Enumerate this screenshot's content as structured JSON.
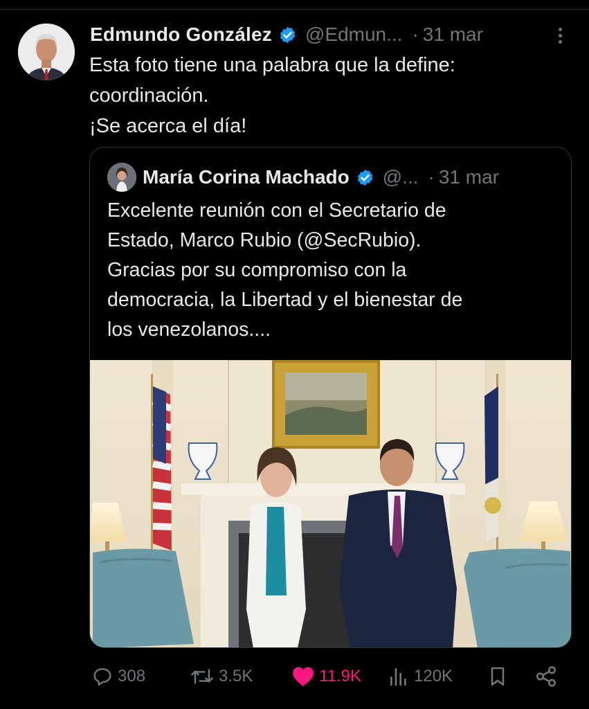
{
  "tweet": {
    "author_name": "Edmundo González",
    "author_handle": "@Edmun...",
    "separator": "·",
    "date": "31 mar",
    "text_lines": [
      "Esta foto tiene una palabra que la define:",
      "coordinación.",
      "¡Se acerca el día!"
    ]
  },
  "quoted": {
    "author_name": "María Corina Machado",
    "author_handle": "@...",
    "separator": "·",
    "date": "31 mar",
    "text_lines": [
      "Excelente reunión con el Secretario de",
      "Estado, Marco Rubio (@SecRubio).",
      "Gracias por su compromiso con la",
      "democracia, la Libertad y el bienestar de",
      "los venezolanos...."
    ]
  },
  "actions": {
    "replies": "308",
    "reposts": "3.5K",
    "likes": "11.9K",
    "views": "120K"
  },
  "colors": {
    "background": "#000000",
    "text": "#e7e9ea",
    "muted": "#71767b",
    "verified": "#1d9bf0",
    "like": "#f91880",
    "border": "#2f3336"
  },
  "icons": [
    "verified-badge-icon",
    "more-options-icon",
    "reply-icon",
    "repost-icon",
    "like-icon",
    "views-icon",
    "bookmark-icon",
    "share-icon"
  ]
}
